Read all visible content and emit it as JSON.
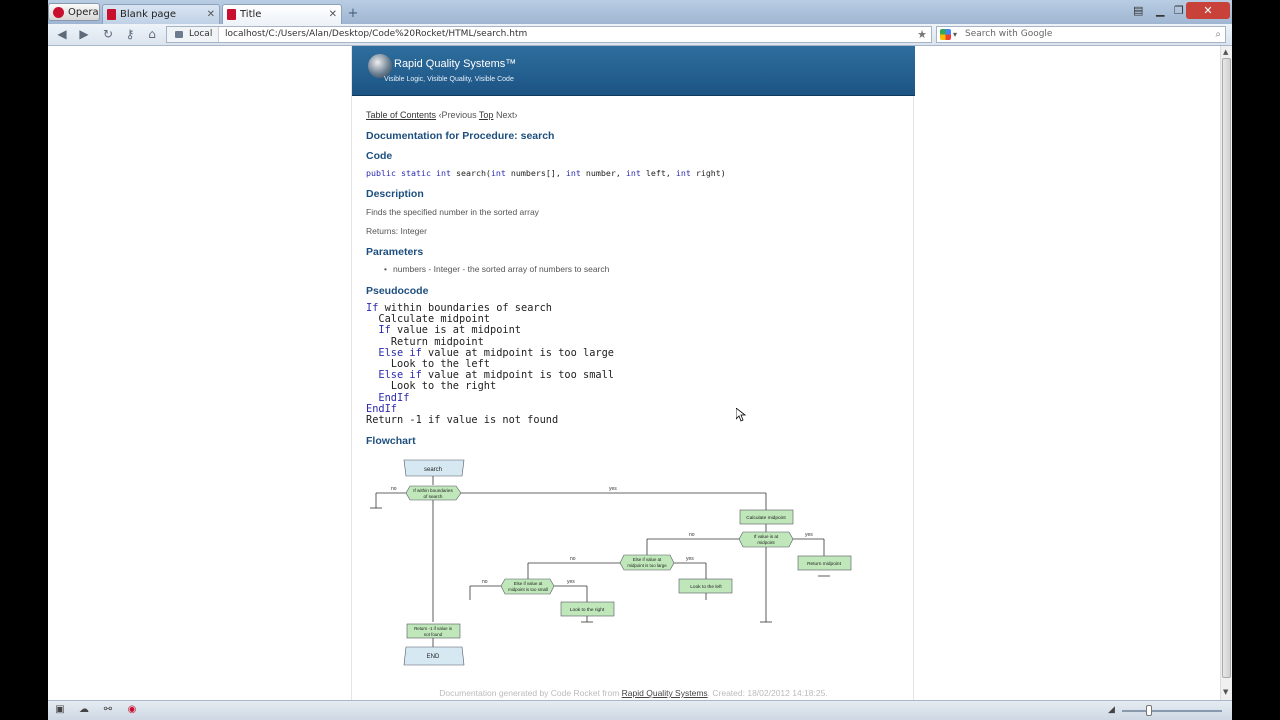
{
  "browser": {
    "menu_label": "Opera",
    "tabs": [
      {
        "label": "Blank page",
        "active": false
      },
      {
        "label": "Title",
        "active": true
      }
    ],
    "new_tab_symbol": "+",
    "address": {
      "local_label": "Local",
      "url": "localhost/C:/Users/Alan/Desktop/Code%20Rocket/HTML/search.htm"
    },
    "search": {
      "placeholder": "Search with Google"
    }
  },
  "page": {
    "banner": {
      "title": "Rapid Quality Systems™",
      "tagline": "Visible Logic, Visible Quality, Visible Code"
    },
    "nav": {
      "toc": "Table of Contents",
      "previous": "‹Previous",
      "top": "Top",
      "next": "Next›"
    },
    "doc_heading": "Documentation for Procedure: search",
    "code_heading": "Code",
    "code_signature": {
      "public": "public",
      "static": "static",
      "int1": "int",
      "name": " search(",
      "int2": "int",
      "p1": " numbers[], ",
      "int3": "int",
      "p2": " number, ",
      "int4": "int",
      "p3": " left, ",
      "int5": "int",
      "p4": " right)"
    },
    "description_heading": "Description",
    "description": "Finds the specified number in the sorted array",
    "returns": "Returns: Integer",
    "parameters_heading": "Parameters",
    "parameters": [
      "numbers - Integer - the sorted array of numbers to search"
    ],
    "pseudocode_heading": "Pseudocode",
    "pseudocode": [
      {
        "indent": "",
        "kw": "If",
        "text": " within boundaries of search"
      },
      {
        "indent": "  ",
        "kw": "",
        "text": "Calculate midpoint"
      },
      {
        "indent": "  ",
        "kw": "If",
        "text": " value is at midpoint"
      },
      {
        "indent": "    ",
        "kw": "",
        "text": "Return midpoint"
      },
      {
        "indent": "  ",
        "kw": "Else if",
        "text": " value at midpoint is too large"
      },
      {
        "indent": "    ",
        "kw": "",
        "text": "Look to the left"
      },
      {
        "indent": "  ",
        "kw": "Else if",
        "text": " value at midpoint is too small"
      },
      {
        "indent": "    ",
        "kw": "",
        "text": "Look to the right"
      },
      {
        "indent": "  ",
        "kw": "EndIf",
        "text": ""
      },
      {
        "indent": "",
        "kw": "EndIf",
        "text": ""
      },
      {
        "indent": "",
        "kw": "",
        "text": "Return -1 if value is not found"
      }
    ],
    "flowchart_heading": "Flowchart",
    "flowchart": {
      "start": "search",
      "cond1": [
        "If within boundaries",
        "of search"
      ],
      "calc": "Calculate midpoint",
      "cond2": [
        "If value is at",
        "midpoint"
      ],
      "ret_mid": "Return midpoint",
      "cond3": [
        "Else if value at",
        "midpoint is too large"
      ],
      "left": "Look to the left",
      "cond4": [
        "Else if value at",
        "midpoint is too small"
      ],
      "right": "Look to the right",
      "ret_neg": [
        "Return -1 if value is",
        "not found"
      ],
      "end": "END",
      "yes": "yes",
      "no": "no"
    },
    "footer": {
      "prefix": "Documentation generated by Code Rocket from ",
      "link": "Rapid Quality Systems",
      "suffix": ". Created: 18/02/2012 14:18:25."
    }
  },
  "icons": [
    "opera-logo-icon",
    "back-icon",
    "forward-icon",
    "reload-icon",
    "key-icon",
    "home-icon",
    "star-icon",
    "google-icon",
    "search-icon",
    "close-icon",
    "minimize-icon",
    "maximize-icon"
  ]
}
